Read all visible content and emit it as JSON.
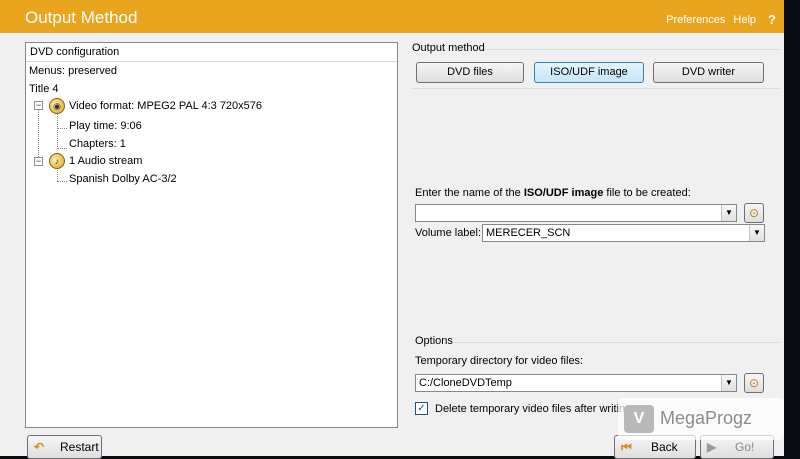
{
  "window": {
    "title": "Output Method",
    "links": {
      "preferences": "Preferences",
      "help": "Help",
      "help_icon": "?"
    }
  },
  "dvd_config": {
    "header": "DVD configuration",
    "menus": "Menus: preserved",
    "title": "Title 4",
    "video_format": "Video format: MPEG2 PAL  4:3 720x576",
    "play_time": "Play time: 9:06",
    "chapters": "Chapters: 1",
    "audio_stream": "1 Audio stream",
    "audio_detail": "Spanish Dolby AC-3/2",
    "icons": {
      "video": "eye-icon",
      "audio": "speaker-icon"
    }
  },
  "output_method": {
    "label": "Output method",
    "buttons": {
      "dvd_files": "DVD files",
      "iso_udf": "ISO/UDF image",
      "dvd_writer": "DVD writer"
    },
    "selected": "iso_udf",
    "filename_prompt_pre": "Enter the name of the ",
    "filename_prompt_bold": "ISO/UDF image",
    "filename_prompt_post": " file to be created:",
    "filename_value": "",
    "volume_label": "Volume label:",
    "volume_value": "MERECER_SCN"
  },
  "options": {
    "label": "Options",
    "temp_dir_label": "Temporary directory for video files:",
    "temp_dir_value": "C:/CloneDVDTemp",
    "delete_temp_label": "Delete temporary video files after writing",
    "delete_temp_checked": true
  },
  "footer": {
    "restart": "Restart",
    "back": "Back",
    "go": "Go!"
  },
  "watermark": {
    "text": "MegaProgz"
  }
}
